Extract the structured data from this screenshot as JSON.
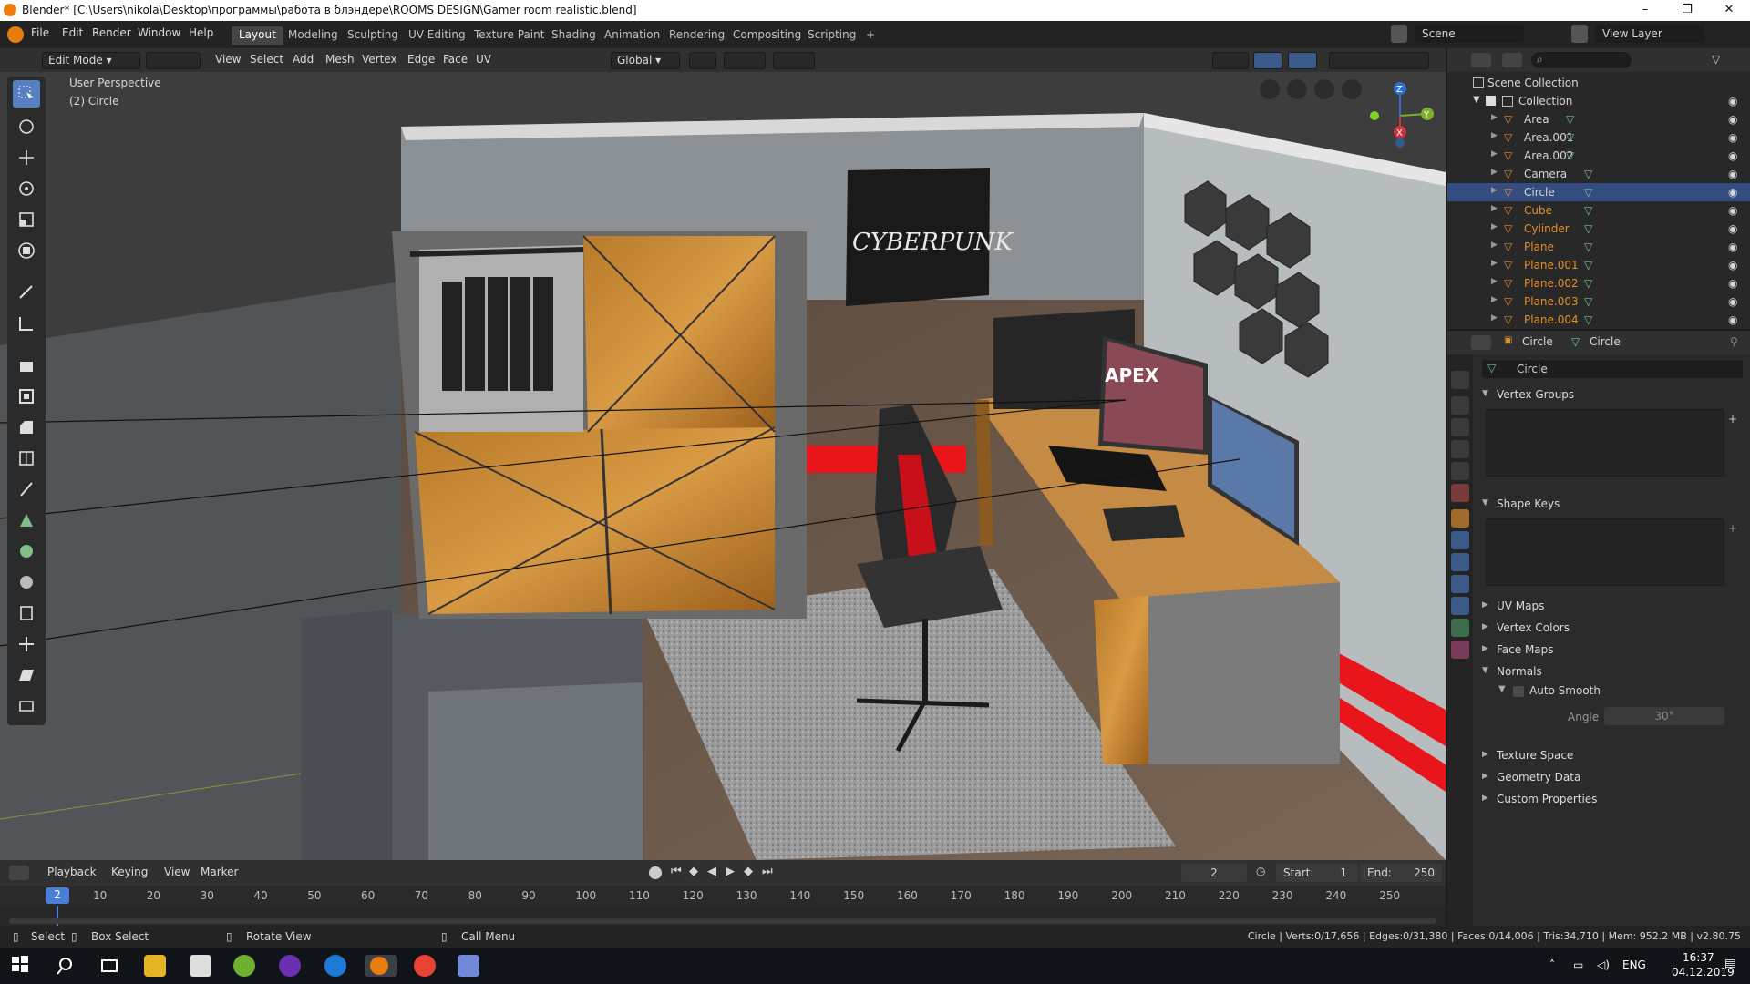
{
  "window": {
    "title": "Blender* [C:\\Users\\nikola\\Desktop\\программы\\работа в блэндере\\ROOMS DESIGN\\Gamer room realistic.blend]",
    "controls": [
      "–",
      "❐",
      "✕"
    ]
  },
  "menu": [
    "File",
    "Edit",
    "Render",
    "Window",
    "Help"
  ],
  "workspaces": [
    "Layout",
    "Modeling",
    "Sculpting",
    "UV Editing",
    "Texture Paint",
    "Shading",
    "Animation",
    "Rendering",
    "Compositing",
    "Scripting",
    "+"
  ],
  "scene": {
    "label": "Scene",
    "view_layer": "View Layer"
  },
  "viewport_header": {
    "mode": "Edit Mode",
    "menus": [
      "View",
      "Select",
      "Add",
      "Mesh",
      "Vertex",
      "Edge",
      "Face",
      "UV"
    ],
    "orientation": "Global"
  },
  "viewport": {
    "perspective": "User Perspective",
    "object": "(2) Circle",
    "poster_text": "CYBERPUNK",
    "monitor_text": "APEX",
    "gizmo": {
      "z": "Z",
      "y": "Y",
      "x": "X"
    }
  },
  "outliner": {
    "scene_collection": "Scene Collection",
    "collection": "Collection",
    "items": [
      "Area",
      "Area.001",
      "Area.002",
      "Camera",
      "Circle",
      "Cube",
      "Cylinder",
      "Plane",
      "Plane.001",
      "Plane.002",
      "Plane.003",
      "Plane.004"
    ],
    "selected": "Circle"
  },
  "properties": {
    "breadcrumb_object": "Circle",
    "breadcrumb_mesh": "Circle",
    "mesh_name": "Circle",
    "panels": {
      "vertex_groups": "Vertex Groups",
      "shape_keys": "Shape Keys",
      "uv_maps": "UV Maps",
      "vertex_colors": "Vertex Colors",
      "face_maps": "Face Maps",
      "normals": "Normals",
      "auto_smooth": "Auto Smooth",
      "angle_label": "Angle",
      "angle_value": "30°",
      "texture_space": "Texture Space",
      "geometry_data": "Geometry Data",
      "custom_properties": "Custom Properties"
    }
  },
  "timeline": {
    "menus": [
      "Playback",
      "Keying",
      "View",
      "Marker"
    ],
    "current_frame": "2",
    "start_label": "Start:",
    "start": "1",
    "end_label": "End:",
    "end": "250",
    "ticks": [
      "10",
      "20",
      "30",
      "40",
      "50",
      "60",
      "70",
      "80",
      "90",
      "100",
      "110",
      "120",
      "130",
      "140",
      "150",
      "160",
      "170",
      "180",
      "190",
      "200",
      "210",
      "220",
      "230",
      "240",
      "250"
    ],
    "cursor": "2"
  },
  "status": {
    "select": "Select",
    "box_select": "Box Select",
    "rotate": "Rotate View",
    "call_menu": "Call Menu",
    "stats": "Circle | Verts:0/17,656 | Edges:0/31,380 | Faces:0/14,006 | Tris:34,710 | Mem: 952.2 MB | v2.80.75"
  },
  "taskbar": {
    "lang": "ENG",
    "time": "16:37",
    "date": "04.12.2019"
  },
  "colors": {
    "accent": "#5680c2",
    "selected_row": "#334d80",
    "object_orange": "#e58f2a",
    "red_led": "#e8161b"
  }
}
